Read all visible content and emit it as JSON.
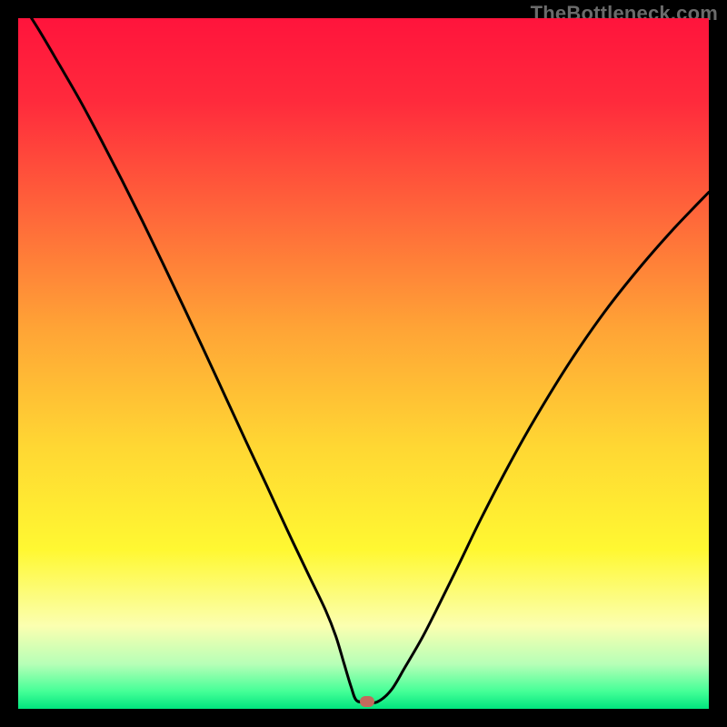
{
  "watermark": {
    "text": "TheBottleneck.com"
  },
  "chart_data": {
    "type": "line",
    "title": "",
    "xlabel": "",
    "ylabel": "",
    "xlim": [
      0,
      100
    ],
    "ylim": [
      0,
      100
    ],
    "series": [
      {
        "name": "bottleneck-curve",
        "x": [
          0,
          3,
          6,
          9,
          12,
          15,
          18,
          21,
          24,
          27,
          30,
          33,
          36,
          39,
          42,
          44.5,
          46,
          47.2,
          48.2,
          49,
          50.5,
          52,
          54,
          56,
          58.5,
          61,
          64,
          67,
          71,
          75,
          80,
          85,
          90,
          95,
          100
        ],
        "y": [
          103,
          98.3,
          93.2,
          88.0,
          82.4,
          76.6,
          70.6,
          64.4,
          58.1,
          51.7,
          45.2,
          38.7,
          32.3,
          25.8,
          19.5,
          14.3,
          10.5,
          6.5,
          3.2,
          1.2,
          1.0,
          1.0,
          2.7,
          6.0,
          10.3,
          15.2,
          21.3,
          27.5,
          35.2,
          42.3,
          50.4,
          57.6,
          63.9,
          69.6,
          74.8
        ]
      }
    ],
    "marker": {
      "x": 50.5,
      "y": 1.0,
      "color": "#c26a5c"
    },
    "gradient_stops": [
      {
        "pos": 0.0,
        "color": "#ff143c"
      },
      {
        "pos": 0.12,
        "color": "#ff2a3c"
      },
      {
        "pos": 0.28,
        "color": "#ff653a"
      },
      {
        "pos": 0.45,
        "color": "#ffa436"
      },
      {
        "pos": 0.62,
        "color": "#ffd733"
      },
      {
        "pos": 0.77,
        "color": "#fff832"
      },
      {
        "pos": 0.88,
        "color": "#fbffb0"
      },
      {
        "pos": 0.935,
        "color": "#b7ffb7"
      },
      {
        "pos": 0.975,
        "color": "#44ff97"
      },
      {
        "pos": 1.0,
        "color": "#00e57e"
      }
    ]
  }
}
